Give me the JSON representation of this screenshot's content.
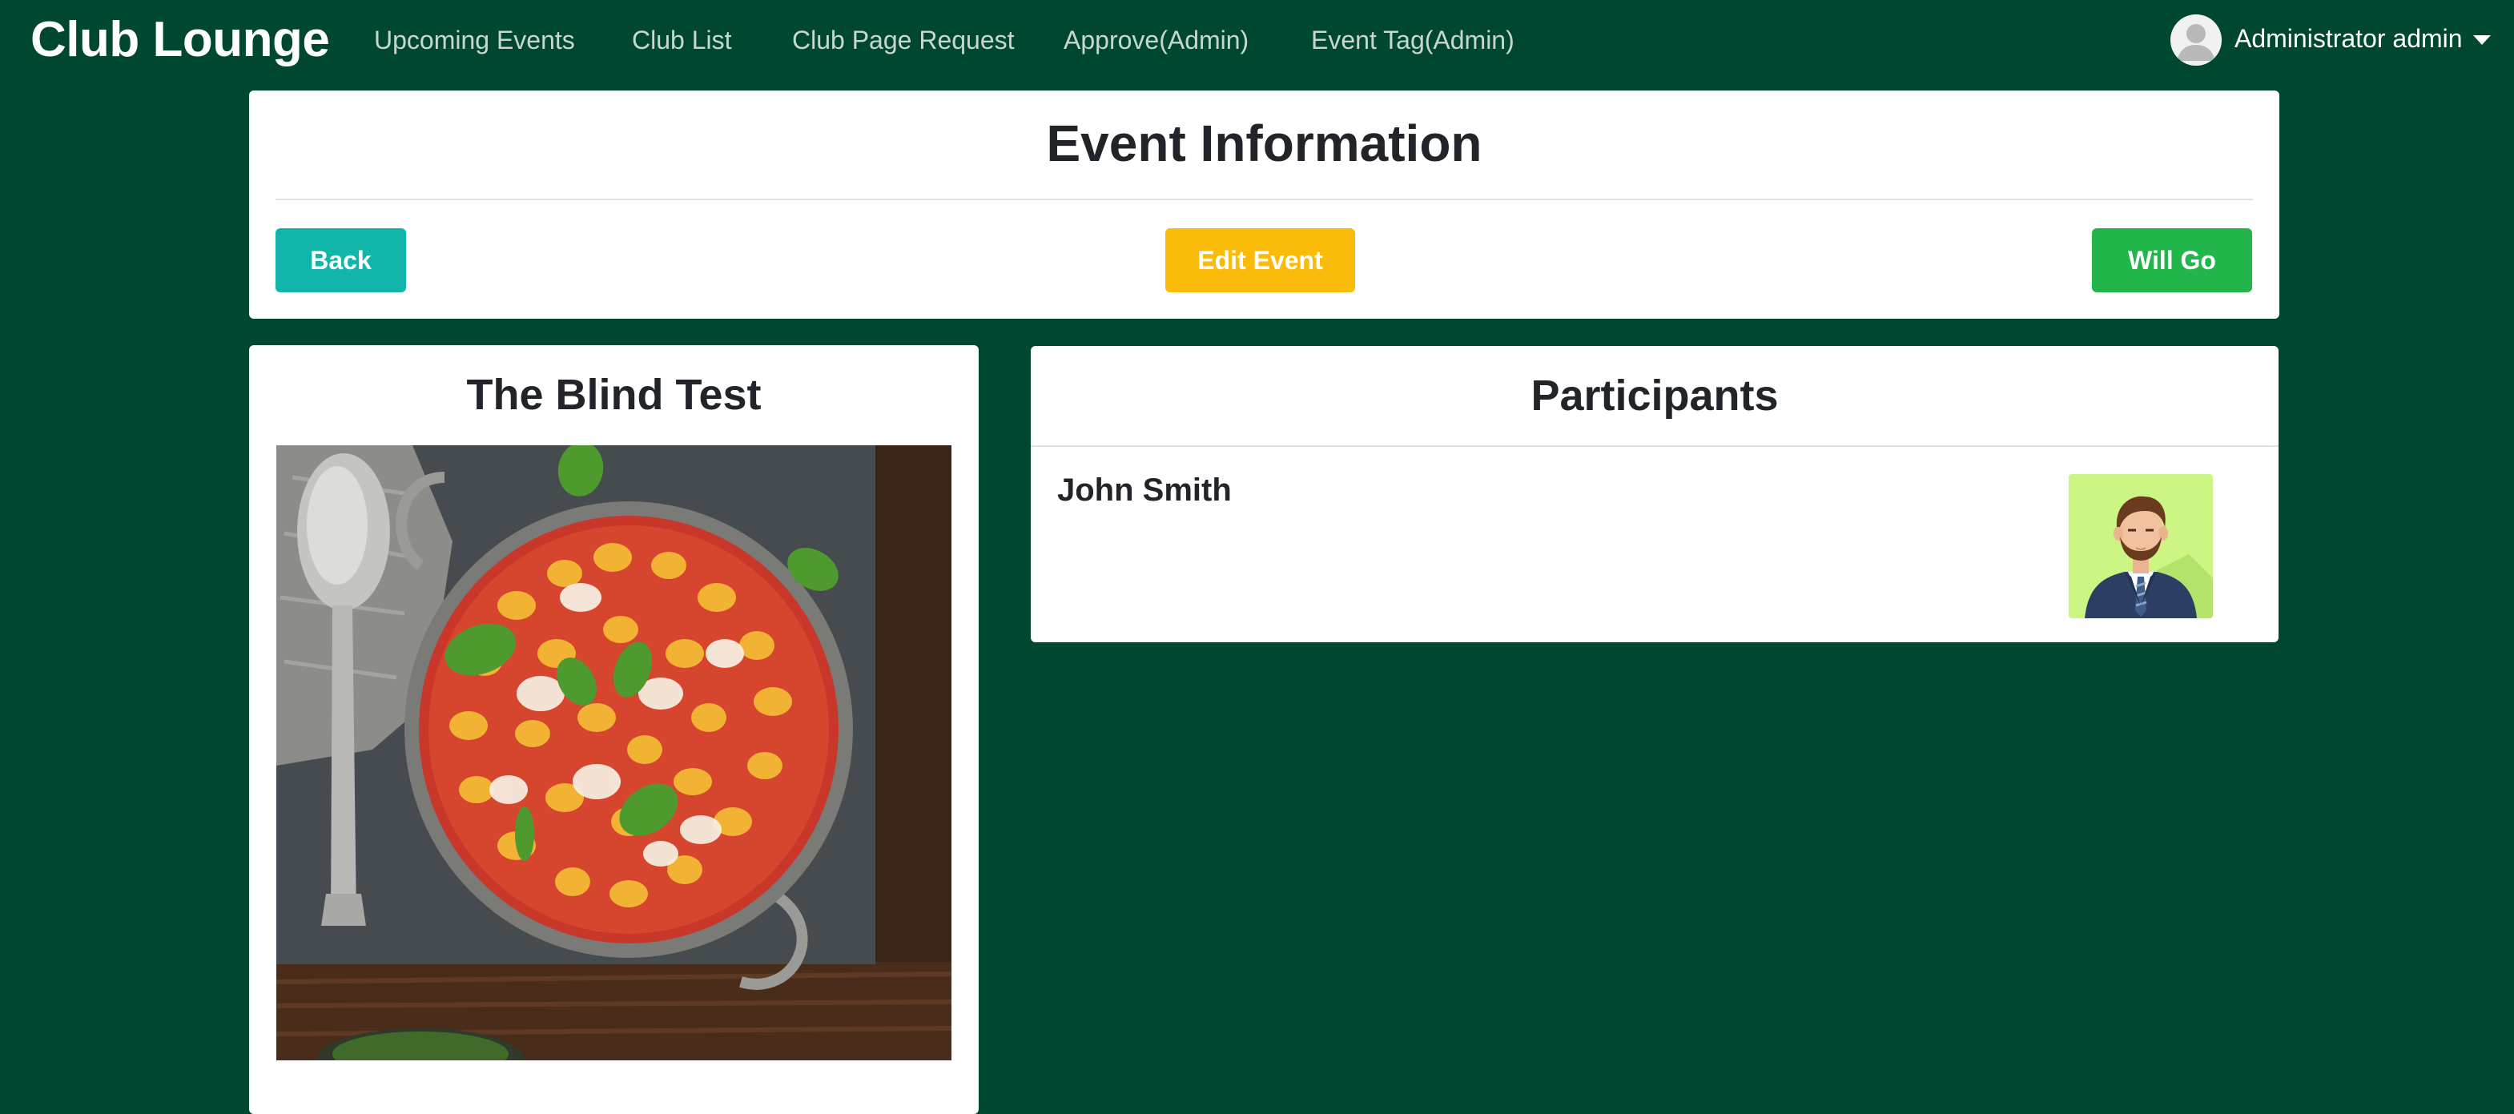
{
  "app": {
    "brand": "Club Lounge"
  },
  "nav": {
    "links": [
      {
        "label": "Upcoming Events"
      },
      {
        "label": "Club List"
      },
      {
        "label": "Club Page Request"
      },
      {
        "label": "Approve(Admin)"
      },
      {
        "label": "Event Tag(Admin)"
      }
    ]
  },
  "user": {
    "name": "Administrator admin",
    "avatar_icon": "user-silhouette-icon",
    "menu_icon": "caret-down-icon"
  },
  "event_header": {
    "title": "Event Information",
    "back_label": "Back",
    "edit_label": "Edit Event",
    "will_go_label": "Will Go"
  },
  "event": {
    "name": "The Blind Test",
    "image_subject": "baked gnocchi with tomato, mozzarella and basil in a pan"
  },
  "participants": {
    "title": "Participants",
    "items": [
      {
        "name": "John Smith",
        "avatar": "businessman-avatar"
      }
    ]
  },
  "colors": {
    "navbar_bg": "#004731",
    "back_button": "#12b5a9",
    "edit_button": "#fbbb0b",
    "will_go_button": "#22b64a",
    "avatar_bg": "#cdf584"
  }
}
